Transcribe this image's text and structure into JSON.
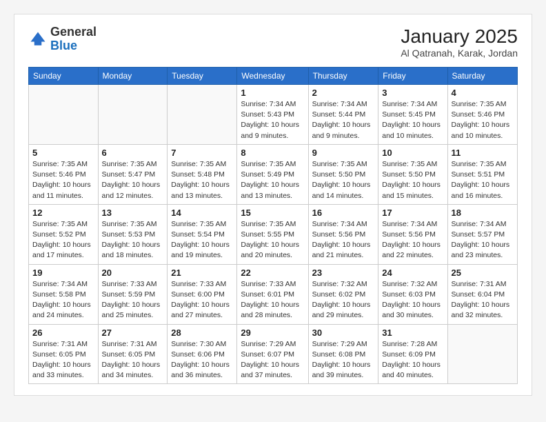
{
  "header": {
    "logo_general": "General",
    "logo_blue": "Blue",
    "title": "January 2025",
    "location": "Al Qatranah, Karak, Jordan"
  },
  "days_of_week": [
    "Sunday",
    "Monday",
    "Tuesday",
    "Wednesday",
    "Thursday",
    "Friday",
    "Saturday"
  ],
  "weeks": [
    [
      {
        "day": "",
        "info": ""
      },
      {
        "day": "",
        "info": ""
      },
      {
        "day": "",
        "info": ""
      },
      {
        "day": "1",
        "info": "Sunrise: 7:34 AM\nSunset: 5:43 PM\nDaylight: 10 hours\nand 9 minutes."
      },
      {
        "day": "2",
        "info": "Sunrise: 7:34 AM\nSunset: 5:44 PM\nDaylight: 10 hours\nand 9 minutes."
      },
      {
        "day": "3",
        "info": "Sunrise: 7:34 AM\nSunset: 5:45 PM\nDaylight: 10 hours\nand 10 minutes."
      },
      {
        "day": "4",
        "info": "Sunrise: 7:35 AM\nSunset: 5:46 PM\nDaylight: 10 hours\nand 10 minutes."
      }
    ],
    [
      {
        "day": "5",
        "info": "Sunrise: 7:35 AM\nSunset: 5:46 PM\nDaylight: 10 hours\nand 11 minutes."
      },
      {
        "day": "6",
        "info": "Sunrise: 7:35 AM\nSunset: 5:47 PM\nDaylight: 10 hours\nand 12 minutes."
      },
      {
        "day": "7",
        "info": "Sunrise: 7:35 AM\nSunset: 5:48 PM\nDaylight: 10 hours\nand 13 minutes."
      },
      {
        "day": "8",
        "info": "Sunrise: 7:35 AM\nSunset: 5:49 PM\nDaylight: 10 hours\nand 13 minutes."
      },
      {
        "day": "9",
        "info": "Sunrise: 7:35 AM\nSunset: 5:50 PM\nDaylight: 10 hours\nand 14 minutes."
      },
      {
        "day": "10",
        "info": "Sunrise: 7:35 AM\nSunset: 5:50 PM\nDaylight: 10 hours\nand 15 minutes."
      },
      {
        "day": "11",
        "info": "Sunrise: 7:35 AM\nSunset: 5:51 PM\nDaylight: 10 hours\nand 16 minutes."
      }
    ],
    [
      {
        "day": "12",
        "info": "Sunrise: 7:35 AM\nSunset: 5:52 PM\nDaylight: 10 hours\nand 17 minutes."
      },
      {
        "day": "13",
        "info": "Sunrise: 7:35 AM\nSunset: 5:53 PM\nDaylight: 10 hours\nand 18 minutes."
      },
      {
        "day": "14",
        "info": "Sunrise: 7:35 AM\nSunset: 5:54 PM\nDaylight: 10 hours\nand 19 minutes."
      },
      {
        "day": "15",
        "info": "Sunrise: 7:35 AM\nSunset: 5:55 PM\nDaylight: 10 hours\nand 20 minutes."
      },
      {
        "day": "16",
        "info": "Sunrise: 7:34 AM\nSunset: 5:56 PM\nDaylight: 10 hours\nand 21 minutes."
      },
      {
        "day": "17",
        "info": "Sunrise: 7:34 AM\nSunset: 5:56 PM\nDaylight: 10 hours\nand 22 minutes."
      },
      {
        "day": "18",
        "info": "Sunrise: 7:34 AM\nSunset: 5:57 PM\nDaylight: 10 hours\nand 23 minutes."
      }
    ],
    [
      {
        "day": "19",
        "info": "Sunrise: 7:34 AM\nSunset: 5:58 PM\nDaylight: 10 hours\nand 24 minutes."
      },
      {
        "day": "20",
        "info": "Sunrise: 7:33 AM\nSunset: 5:59 PM\nDaylight: 10 hours\nand 25 minutes."
      },
      {
        "day": "21",
        "info": "Sunrise: 7:33 AM\nSunset: 6:00 PM\nDaylight: 10 hours\nand 27 minutes."
      },
      {
        "day": "22",
        "info": "Sunrise: 7:33 AM\nSunset: 6:01 PM\nDaylight: 10 hours\nand 28 minutes."
      },
      {
        "day": "23",
        "info": "Sunrise: 7:32 AM\nSunset: 6:02 PM\nDaylight: 10 hours\nand 29 minutes."
      },
      {
        "day": "24",
        "info": "Sunrise: 7:32 AM\nSunset: 6:03 PM\nDaylight: 10 hours\nand 30 minutes."
      },
      {
        "day": "25",
        "info": "Sunrise: 7:31 AM\nSunset: 6:04 PM\nDaylight: 10 hours\nand 32 minutes."
      }
    ],
    [
      {
        "day": "26",
        "info": "Sunrise: 7:31 AM\nSunset: 6:05 PM\nDaylight: 10 hours\nand 33 minutes."
      },
      {
        "day": "27",
        "info": "Sunrise: 7:31 AM\nSunset: 6:05 PM\nDaylight: 10 hours\nand 34 minutes."
      },
      {
        "day": "28",
        "info": "Sunrise: 7:30 AM\nSunset: 6:06 PM\nDaylight: 10 hours\nand 36 minutes."
      },
      {
        "day": "29",
        "info": "Sunrise: 7:29 AM\nSunset: 6:07 PM\nDaylight: 10 hours\nand 37 minutes."
      },
      {
        "day": "30",
        "info": "Sunrise: 7:29 AM\nSunset: 6:08 PM\nDaylight: 10 hours\nand 39 minutes."
      },
      {
        "day": "31",
        "info": "Sunrise: 7:28 AM\nSunset: 6:09 PM\nDaylight: 10 hours\nand 40 minutes."
      },
      {
        "day": "",
        "info": ""
      }
    ]
  ]
}
